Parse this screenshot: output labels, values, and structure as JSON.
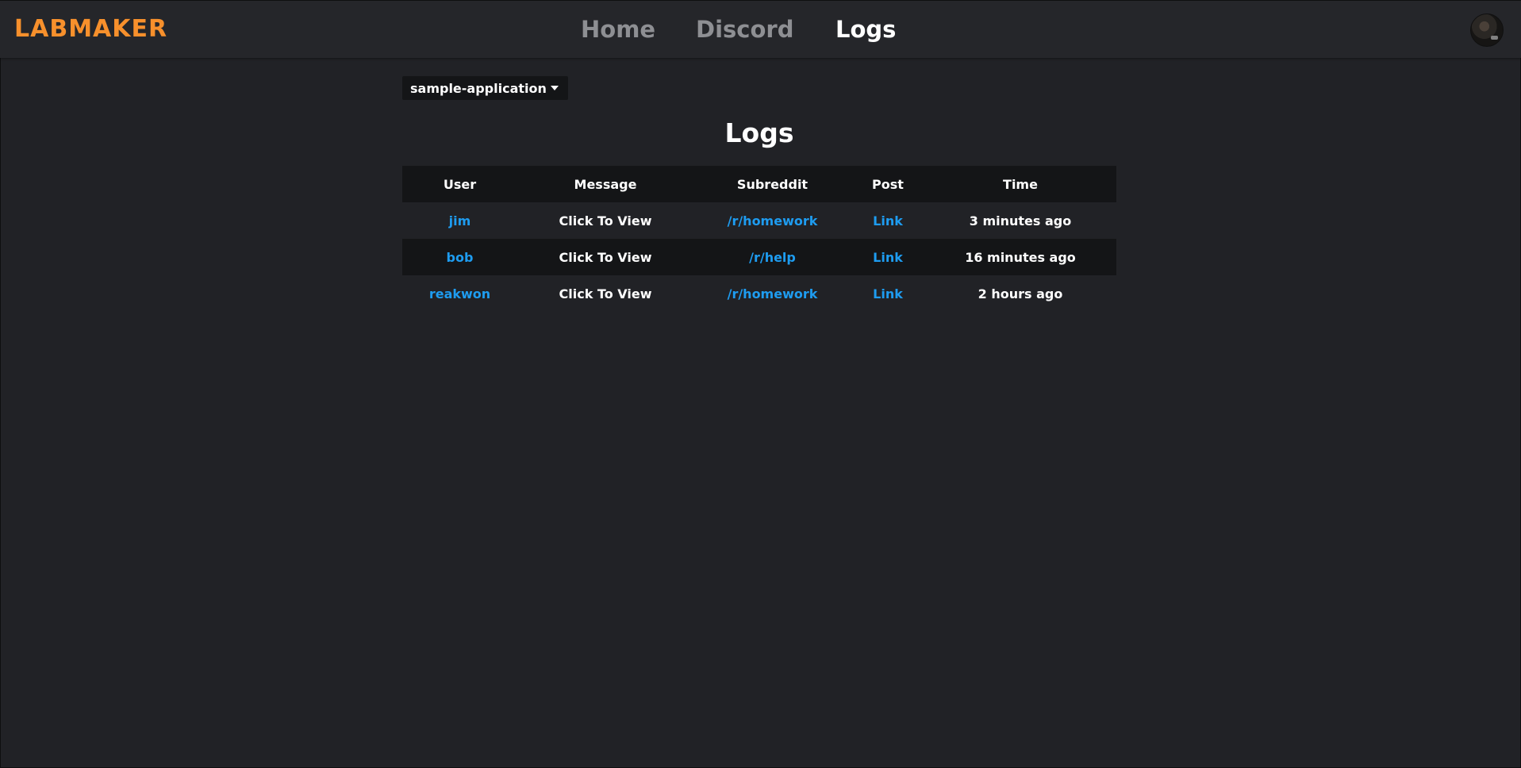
{
  "header": {
    "logo": "LABMAKER",
    "nav": {
      "home": "Home",
      "discord": "Discord",
      "logs": "Logs"
    },
    "active_tab": "Logs"
  },
  "selector": {
    "value": "sample-application"
  },
  "main": {
    "title": "Logs"
  },
  "table": {
    "columns": [
      "User",
      "Message",
      "Subreddit",
      "Post",
      "Time"
    ],
    "rows": [
      {
        "user": "jim",
        "message": "Click To View",
        "subreddit": "/r/homework",
        "post": "Link",
        "time": "3 minutes ago"
      },
      {
        "user": "bob",
        "message": "Click To View",
        "subreddit": "/r/help",
        "post": "Link",
        "time": "16 minutes ago"
      },
      {
        "user": "reakwon",
        "message": "Click To View",
        "subreddit": "/r/homework",
        "post": "Link",
        "time": "2 hours ago"
      }
    ]
  },
  "colors": {
    "background": "#212226",
    "header_background": "#25262a",
    "accent": "#f7902c",
    "link": "#1e9cf0",
    "nav_inactive": "#8e8f93",
    "table_dark": "#141517"
  }
}
